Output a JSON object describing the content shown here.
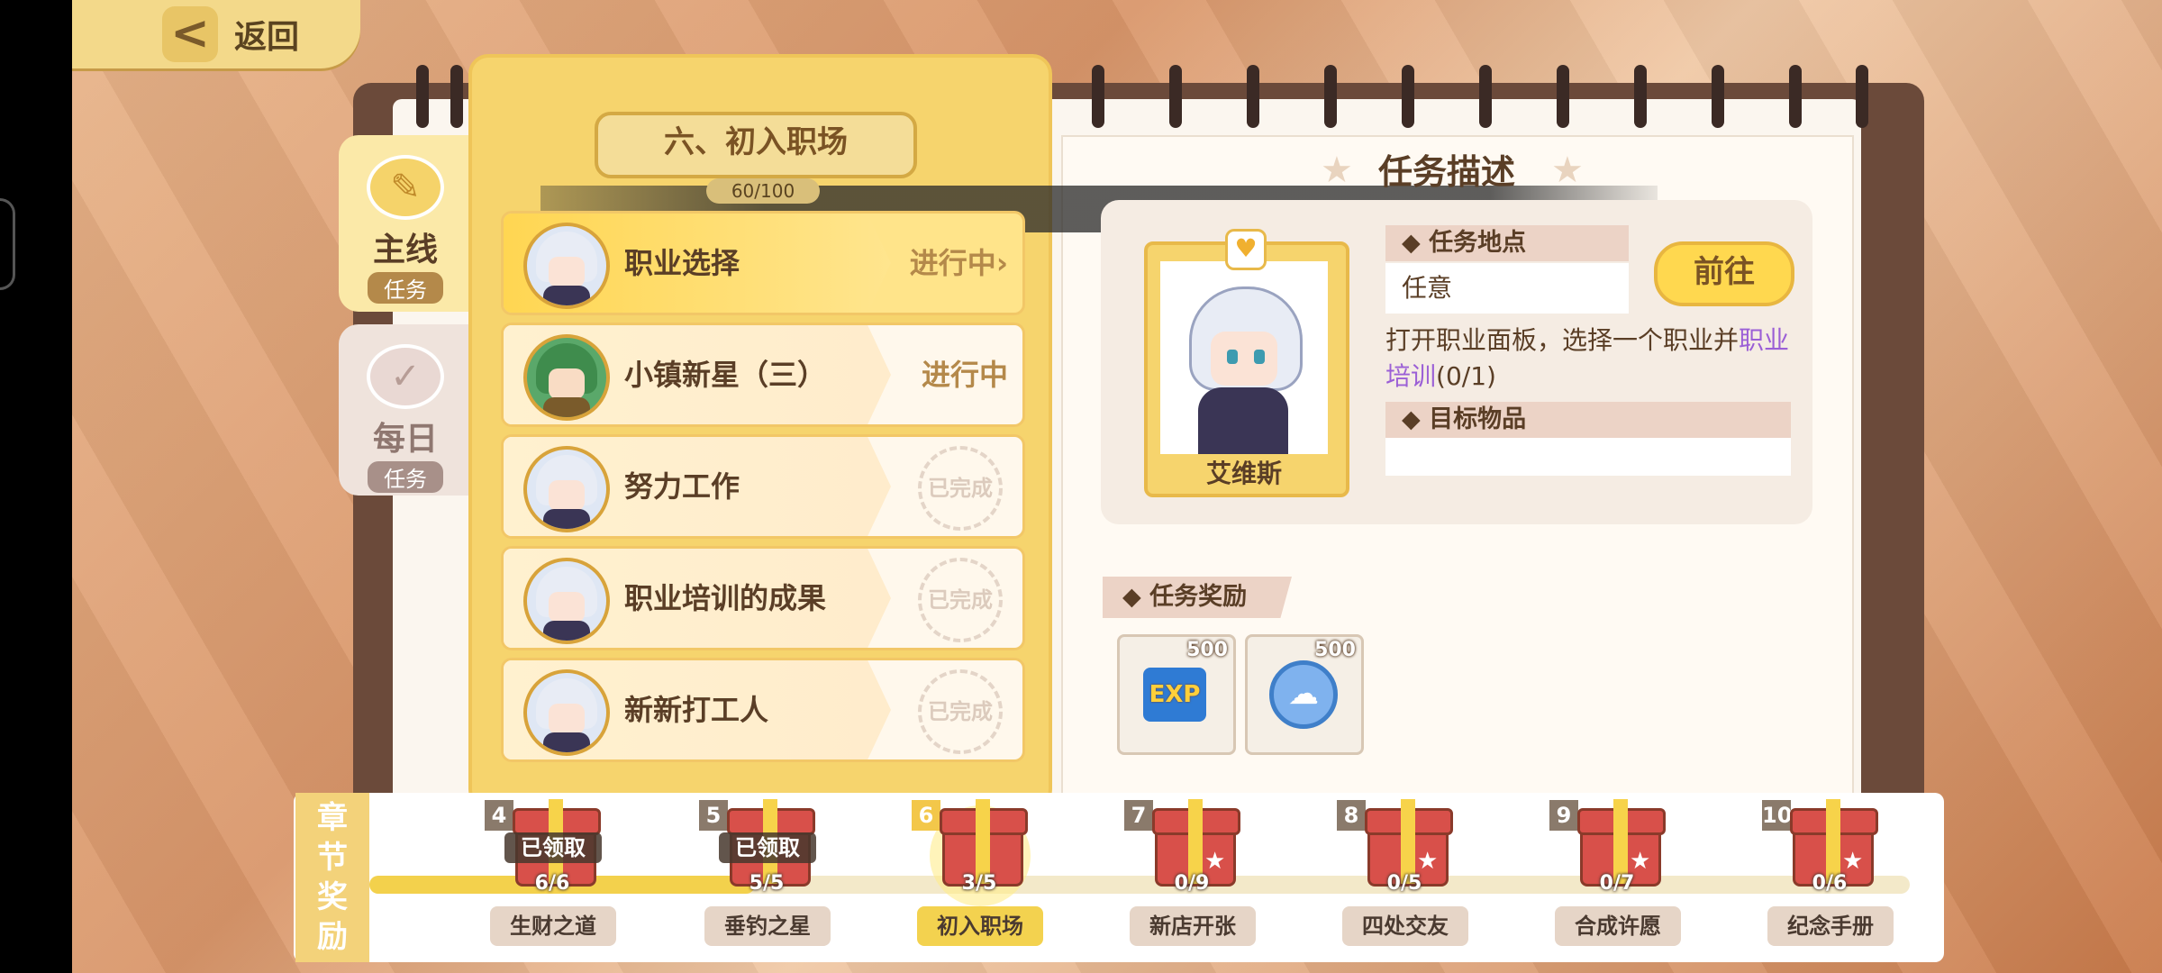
{
  "back": {
    "arrow": "<",
    "label": "返回"
  },
  "tabs": [
    {
      "title": "主线",
      "sub": "任务",
      "icon": "scroll-icon"
    },
    {
      "title": "每日",
      "sub": "任务",
      "icon": "calendar-check-icon"
    }
  ],
  "chapter": {
    "title": "六、初入职场",
    "progress": "60/100"
  },
  "quests": [
    {
      "name": "职业选择",
      "status": "进行中",
      "arrow": "›"
    },
    {
      "name": "小镇新星（三）",
      "status": "进行中"
    },
    {
      "name": "努力工作",
      "status": "已完成"
    },
    {
      "name": "职业培训的成果",
      "status": "已完成"
    },
    {
      "name": "新新打工人",
      "status": "已完成"
    }
  ],
  "detail": {
    "title": "任务描述",
    "location_label": "◆ 任务地点",
    "location_value": "任意",
    "go_button": "前往",
    "description_prefix": "打开职业面板，选择一个职业并",
    "description_highlight": "职业培训",
    "description_suffix": "(0/1)",
    "target_label": "◆ 目标物品",
    "npc_name": "艾维斯",
    "reward_label": "◆ 任务奖励",
    "rewards": [
      {
        "icon": "exp-icon",
        "text": "EXP",
        "count": "500"
      },
      {
        "icon": "coin-icon",
        "text": "☁",
        "count": "500"
      }
    ]
  },
  "chapter_rewards": {
    "title_chars": [
      "章",
      "节",
      "奖",
      "励"
    ],
    "claimed_tag": "已领取",
    "nodes": [
      {
        "num": "4",
        "count": "6/6",
        "label": "生财之道",
        "claimed": true
      },
      {
        "num": "5",
        "count": "5/5",
        "label": "垂钓之星",
        "claimed": true
      },
      {
        "num": "6",
        "count": "3/5",
        "label": "初入职场",
        "current": true
      },
      {
        "num": "7",
        "count": "0/9",
        "label": "新店开张"
      },
      {
        "num": "8",
        "count": "0/5",
        "label": "四处交友"
      },
      {
        "num": "9",
        "count": "0/7",
        "label": "合成许愿"
      },
      {
        "num": "10",
        "count": "0/6",
        "label": "纪念手册"
      }
    ],
    "track_progress": 0.25
  },
  "colors": {
    "accent": "#f6d46d",
    "highlight": "#9b5fd6",
    "text": "#5a3e26"
  }
}
